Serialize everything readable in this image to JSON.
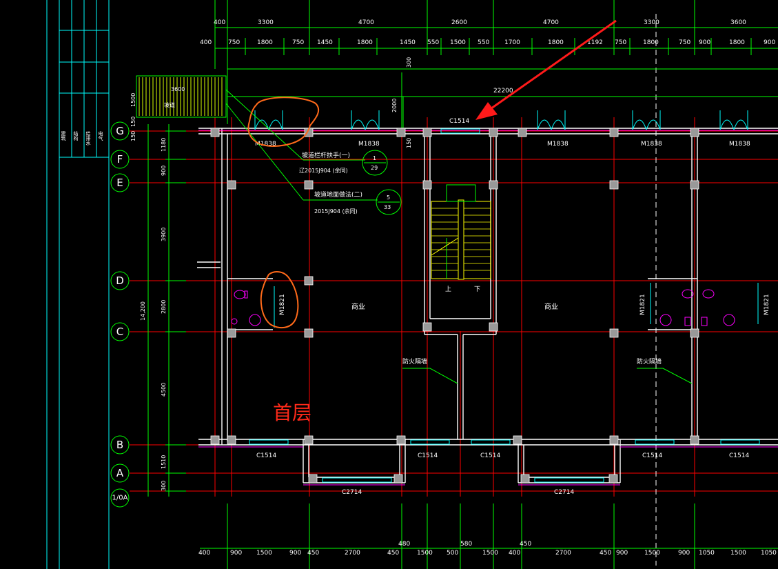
{
  "drawing": {
    "floor_label": "首层",
    "room_label_left": "商业",
    "room_label_right": "商业",
    "stair_up": "上",
    "stair_down": "下",
    "ramp_text_1": "3600",
    "ramp_text_2": "坡道"
  },
  "axes": {
    "rows": [
      "G",
      "F",
      "E",
      "D",
      "C",
      "B",
      "A",
      "1/0A"
    ]
  },
  "dimensions": {
    "top_row1": [
      "400",
      "3300",
      "4700",
      "2600",
      "4700",
      "3300",
      "3600"
    ],
    "top_row2": [
      "400",
      "750",
      "1800",
      "750",
      "1450",
      "1800",
      "1450",
      "550",
      "1500",
      "550",
      "1700",
      "1800",
      "1192",
      "750",
      "1800",
      "750",
      "900",
      "1800",
      "900"
    ],
    "overall": "22200",
    "vertical": [
      "150",
      "1180",
      "900",
      "3900",
      "2800",
      "4500",
      "1510",
      "300"
    ],
    "vertical_total": "14,200",
    "side_small": [
      "1500",
      "150"
    ],
    "stair_dims": [
      "300",
      "2000",
      "150"
    ],
    "bottom_row1": [
      "480",
      "580",
      "450"
    ],
    "bottom_row2": [
      "400",
      "900",
      "1500",
      "900",
      "450",
      "2700",
      "450",
      "1500",
      "500",
      "1500",
      "400",
      "2700",
      "450",
      "900",
      "1500",
      "900",
      "1050",
      "1500",
      "1050"
    ]
  },
  "labels": {
    "doors": [
      "M1838",
      "M1838",
      "M1838",
      "M1838",
      "M1838"
    ],
    "door_m1821": [
      "M1821",
      "M1821",
      "M1821"
    ],
    "windows_top": "C1514",
    "windows_bottom": [
      "C1514",
      "C1514",
      "C1514",
      "C1514",
      "C1514"
    ],
    "windows_big": [
      "C2714",
      "C2714"
    ],
    "fire_wall": [
      "防火隔墙",
      "防火隔墙"
    ]
  },
  "annotations": {
    "note1_text": "坡道栏杆扶手(一)",
    "note1_ref": "辽2015J904    (余同)",
    "note1_num": "1",
    "note1_page": "29",
    "note2_text": "坡道地面做法(二)",
    "note2_ref": "2015J904    (余同)",
    "note2_num": "5",
    "note2_page": "33"
  },
  "title_block": {
    "columns": [
      "建筑",
      "结构",
      "给排水",
      "电气",
      "暖通"
    ],
    "rows": [
      "签名",
      "日期"
    ]
  },
  "colors": {
    "background": "#000000",
    "axis_red": "#ff0000",
    "dimension_green": "#00ff00",
    "wall_white": "#ffffff",
    "window_cyan": "#00ffff",
    "stair_yellow": "#ffff00",
    "fixture_magenta": "#ff00ff",
    "markup_orange": "#ff6a1a",
    "arrow_red": "#ff1a1a"
  }
}
